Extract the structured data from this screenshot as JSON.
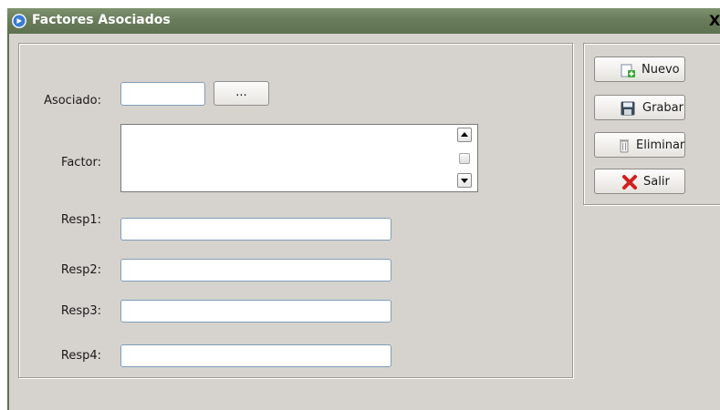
{
  "window": {
    "title": "Factores Asociados",
    "close_label": "X"
  },
  "form": {
    "asociado_label": "Asociado:",
    "asociado_value": "",
    "browse_label": "...",
    "factor_label": "Factor:",
    "factor_value": "",
    "resp1_label": "Resp1:",
    "resp1_value": "",
    "resp2_label": "Resp2:",
    "resp2_value": "",
    "resp3_label": "Resp3:",
    "resp3_value": "",
    "resp4_label": "Resp4:",
    "resp4_value": ""
  },
  "actions": {
    "nuevo": "Nuevo",
    "grabar": "Grabar",
    "eliminar": "Eliminar",
    "salir": "Salir"
  },
  "icons": {
    "title": "circle-arrow-icon",
    "nuevo": "new-document-plus-icon",
    "grabar": "floppy-disk-icon",
    "eliminar": "trash-can-icon",
    "salir": "red-x-icon"
  },
  "colors": {
    "titlebar": "#6a7d5b",
    "window_bg": "#d6d3ce",
    "input_border": "#7f9db9"
  }
}
